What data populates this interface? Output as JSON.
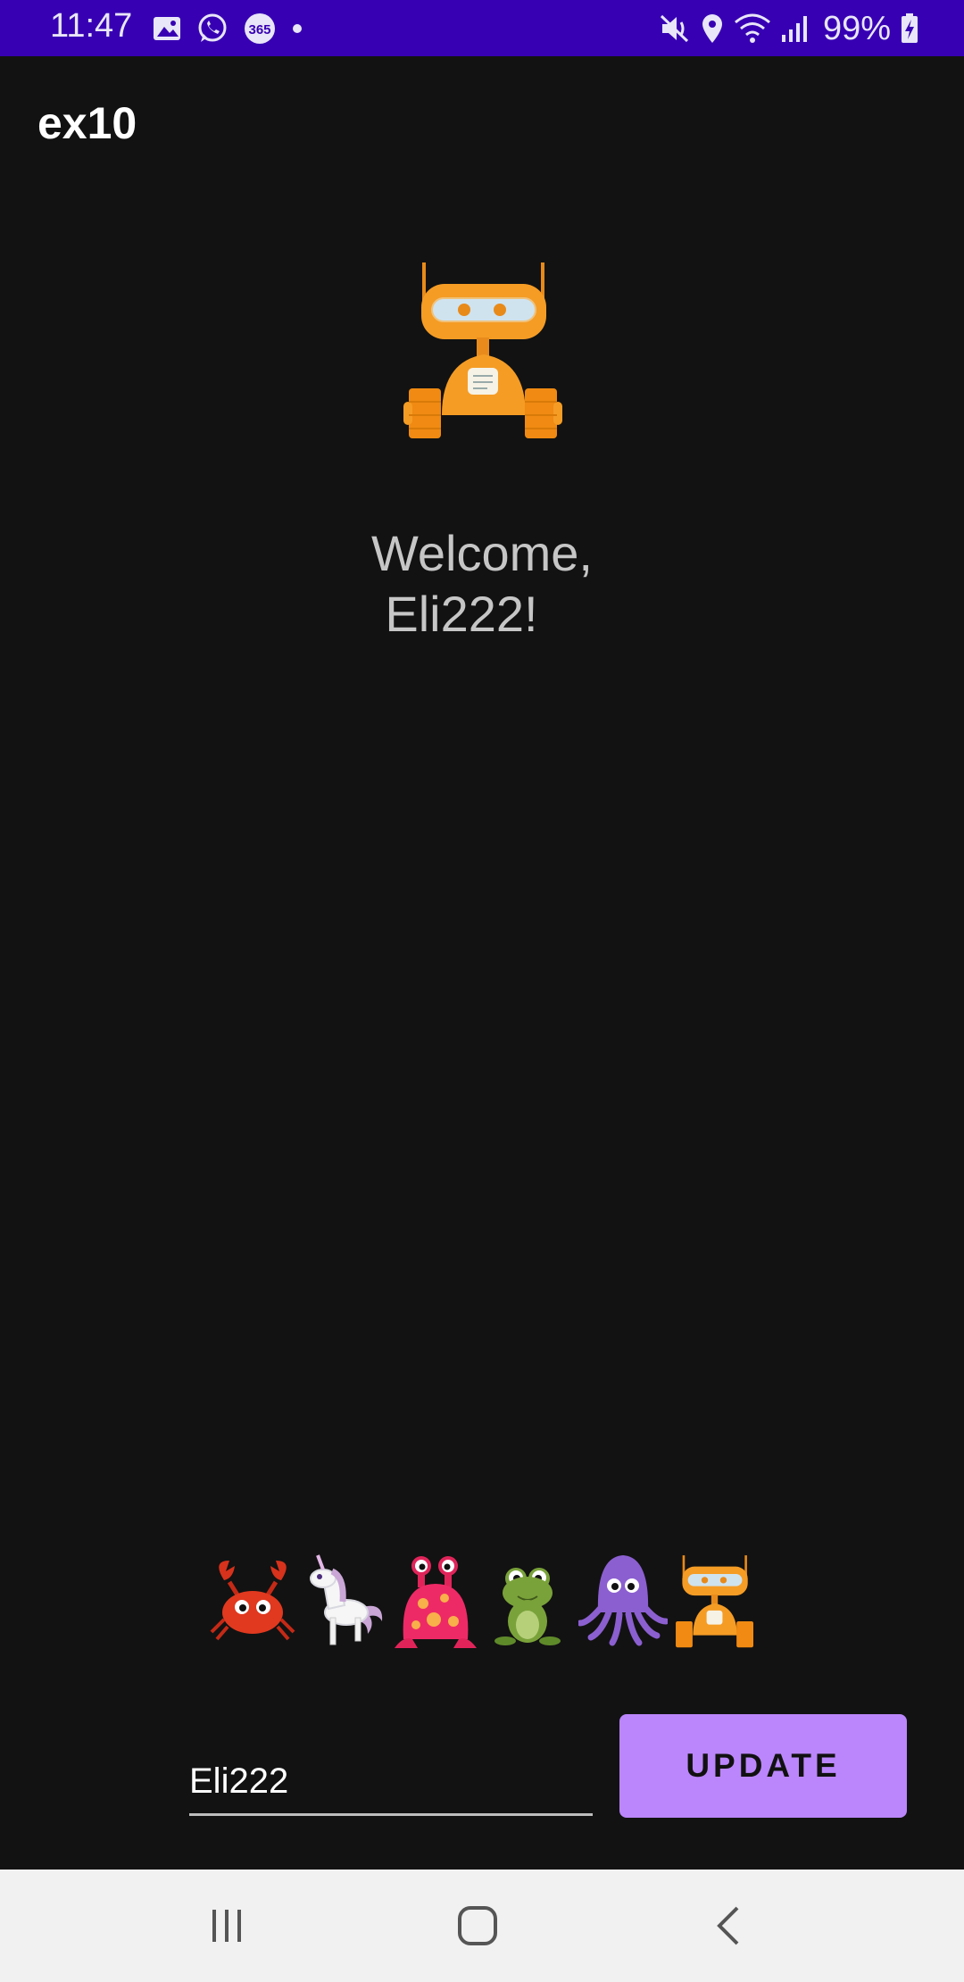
{
  "status_bar": {
    "time": "11:47",
    "battery": "99%",
    "left_icons": [
      "gallery-icon",
      "whatsapp-icon",
      "office365-icon",
      "dot-icon"
    ],
    "right_icons": [
      "mute-icon",
      "location-icon",
      "wifi-icon",
      "signal-icon",
      "battery-charging-icon"
    ]
  },
  "app_bar": {
    "title": "ex10"
  },
  "hero": {
    "avatar": "robot-avatar"
  },
  "welcome": {
    "line1": "Welcome,",
    "line2": "Eli222!"
  },
  "avatar_options": [
    "crab-avatar",
    "unicorn-avatar",
    "monster-avatar",
    "frog-avatar",
    "octopus-avatar",
    "robot-avatar"
  ],
  "form": {
    "name_value": "Eli222",
    "update_label": "UPDATE"
  },
  "nav_bar": {
    "buttons": [
      "recents-icon",
      "home-icon",
      "back-icon"
    ]
  },
  "colors": {
    "status_bar": "#3700b3",
    "background": "#121212",
    "accent": "#bb86fc",
    "nav_bar": "#f1f1f1"
  }
}
